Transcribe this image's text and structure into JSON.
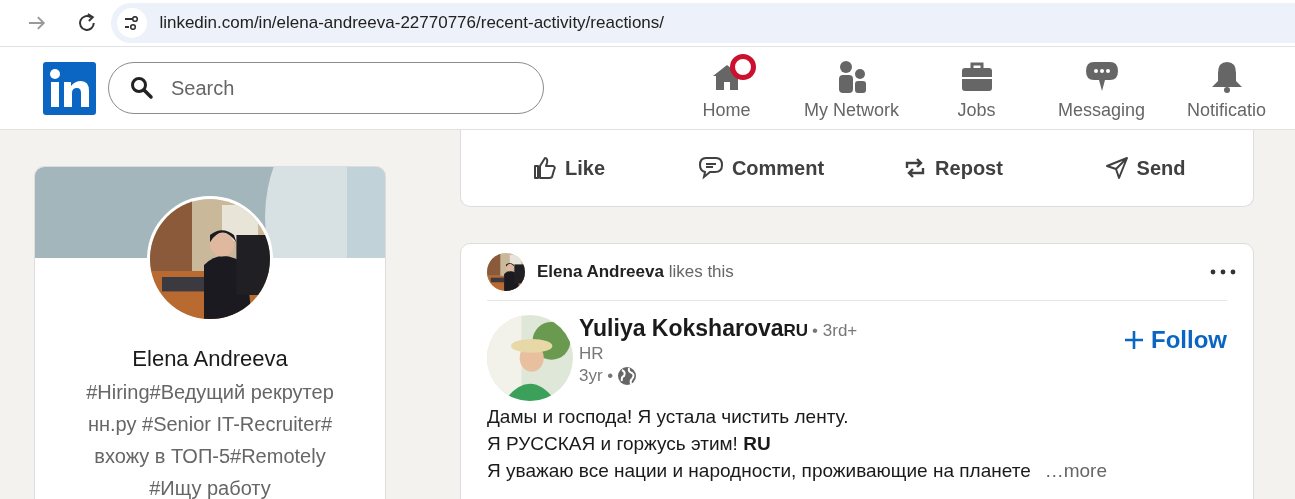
{
  "browser": {
    "url": "linkedin.com/in/elena-andreeva-22770776/recent-activity/reactions/"
  },
  "nav": {
    "search": {
      "placeholder": "Search"
    },
    "items": [
      {
        "label": "Home",
        "kind": "home",
        "badge": true
      },
      {
        "label": "My Network",
        "kind": "network",
        "badge": false
      },
      {
        "label": "Jobs",
        "kind": "jobs",
        "badge": false
      },
      {
        "label": "Messaging",
        "kind": "messaging",
        "badge": false
      },
      {
        "label": "Notificatio",
        "kind": "notifications",
        "badge": false
      }
    ]
  },
  "profile": {
    "name": "Elena Andreeva",
    "headline": "#Hiring#Ведущий рекрутер нн.ру #Senior IT-Recruiter# вхожу в ТОП-5#Remotely #Ищу работу"
  },
  "actions": [
    {
      "label": "Like",
      "kind": "like"
    },
    {
      "label": "Comment",
      "kind": "comment"
    },
    {
      "label": "Repost",
      "kind": "repost"
    },
    {
      "label": "Send",
      "kind": "send"
    }
  ],
  "post": {
    "liker": "Elena Andreeva",
    "liker_suffix": "likes this",
    "author": "Yuliya Koksharova",
    "author_flag": "RU",
    "degree": "• 3rd+",
    "subtitle": "HR",
    "time": "3yr •",
    "follow": "Follow",
    "body": [
      "Дамы и господа! Я устала чистить ленту.",
      "Я РУССКАЯ и горжусь этим! **RU**",
      "Я уважаю все нации и народности, проживающие на планете"
    ],
    "see_more": "…more"
  }
}
